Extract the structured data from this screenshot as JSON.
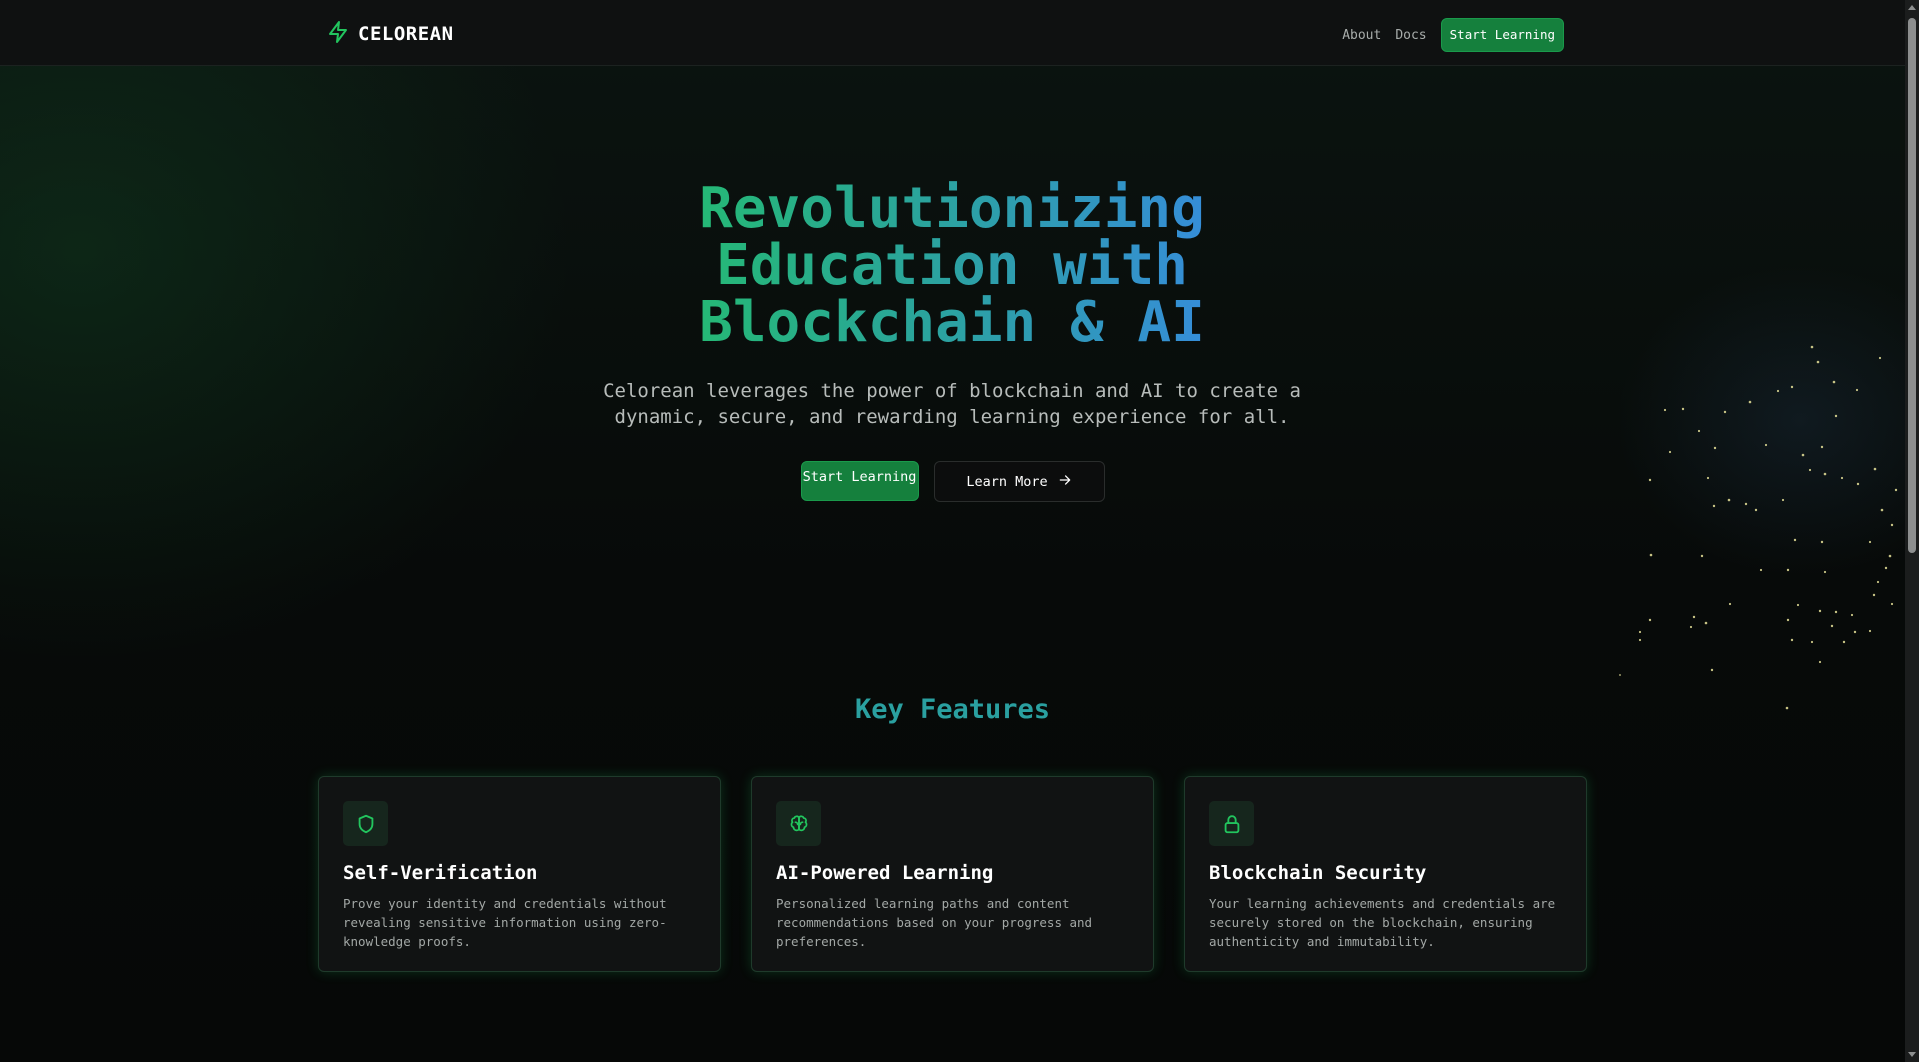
{
  "header": {
    "logo_text": "CELOREAN",
    "logo_icon": "lightning-bolt-icon",
    "nav": [
      {
        "label": "About"
      },
      {
        "label": "Docs"
      }
    ],
    "cta_label": "Start Learning"
  },
  "hero": {
    "title_line1": "Revolutionizing",
    "title_line2": "Education with",
    "title_line3": "Blockchain & AI",
    "subtitle_line1": "Celorean leverages the power of blockchain and AI to create a",
    "subtitle_line2": "dynamic, secure, and rewarding learning experience for all.",
    "primary_button": "Start Learning",
    "secondary_button": "Learn More",
    "secondary_icon": "arrow-right-icon"
  },
  "features": {
    "title": "Key Features",
    "cards": [
      {
        "icon": "shield-icon",
        "title": "Self-Verification",
        "description": "Prove your identity and credentials without revealing sensitive information using zero-knowledge proofs."
      },
      {
        "icon": "brain-icon",
        "title": "AI-Powered Learning",
        "description": "Personalized learning paths and content recommendations based on your progress and preferences."
      },
      {
        "icon": "lock-icon",
        "title": "Blockchain Security",
        "description": "Your learning achievements and credentials are securely stored on the blockchain, ensuring authenticity and immutability."
      }
    ]
  },
  "colors": {
    "accent_green": "#15803d",
    "icon_green": "#22c55e",
    "gradient_start": "#22c55e",
    "gradient_end": "#3b82f6",
    "features_title": "#2aa0a0",
    "background": "#070a09"
  }
}
